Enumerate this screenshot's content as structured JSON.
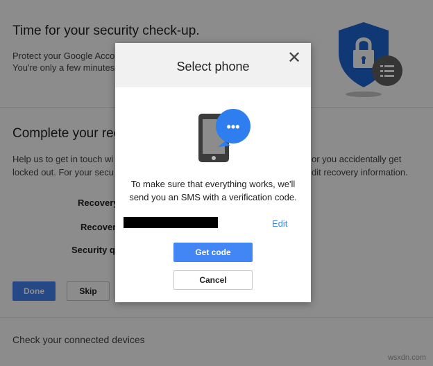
{
  "background": {
    "title": "Time for your security check-up.",
    "desc_line1": "Protect your Google Acco",
    "desc_line2": "You're only a few minutes",
    "section_title": "Complete your rec",
    "help_left_line1": "Help us to get in touch wi",
    "help_left_line2": "locked out. For your secu",
    "help_right_line1": "or you accidentally get",
    "help_right_line2": "dit recovery information.",
    "recovery_label_1": "Recovery",
    "recovery_label_2": "Recover",
    "security_label": "Security qu",
    "done_label": "Done",
    "skip_label": "Skip",
    "devices_label": "Check your connected devices"
  },
  "dialog": {
    "title": "Select phone",
    "close_glyph": "✕",
    "message_line1": "To make sure that everything works, we'll",
    "message_line2": "send you an SMS with a verification code.",
    "edit_label": "Edit",
    "get_code_label": "Get code",
    "cancel_label": "Cancel",
    "bubble_glyph": "•••"
  },
  "watermark": "wsxdn.com",
  "colors": {
    "accent": "#4285f4",
    "shield": "#1e66d6",
    "phone_body": "#3c3c3c",
    "bubble": "#2f7ef0"
  }
}
